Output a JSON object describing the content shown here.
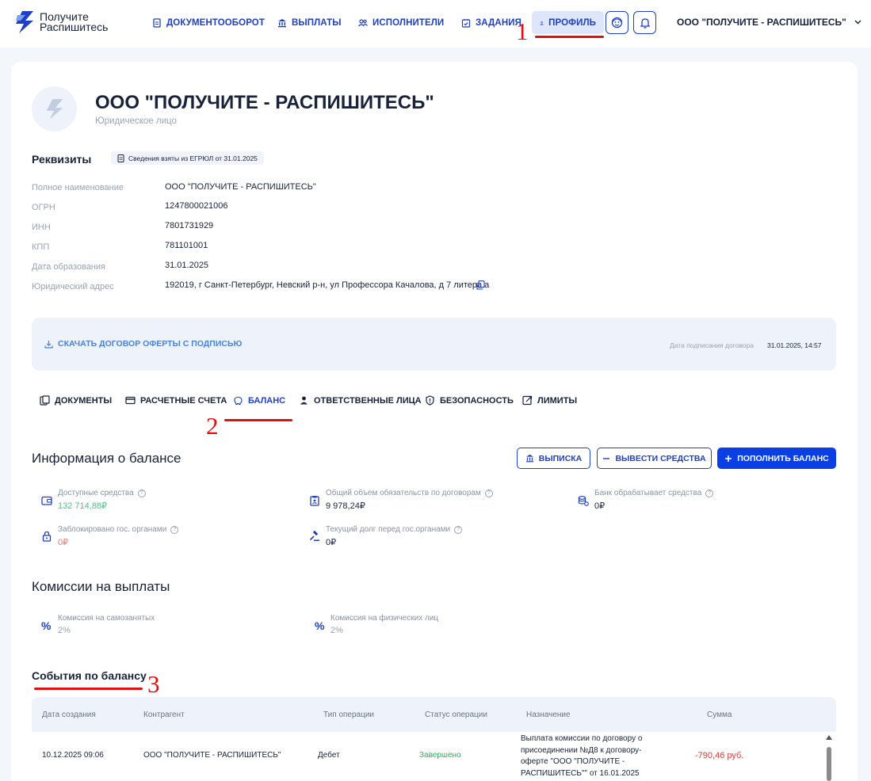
{
  "header": {
    "logo_line1": "Получите",
    "logo_line2": "Распишитесь",
    "nav": [
      {
        "label": "ДОКУМЕНТООБОРОТ",
        "icon": "document-icon"
      },
      {
        "label": "ВЫПЛАТЫ",
        "icon": "bank-icon"
      },
      {
        "label": "ИСПОЛНИТЕЛИ",
        "icon": "users-icon"
      },
      {
        "label": "ЗАДАНИЯ",
        "icon": "calendar-check-icon"
      },
      {
        "label": "ПРОФИЛЬ",
        "icon": "user-icon",
        "active": true
      }
    ],
    "company": "ООО \"ПОЛУЧИТЕ - РАСПИШИТЕСЬ\""
  },
  "annotations": {
    "mark1": "1",
    "mark2": "2",
    "mark3": "3"
  },
  "profile": {
    "name": "ООО \"ПОЛУЧИТЕ - РАСПИШИТЕСЬ\"",
    "type": "Юридическое лицо"
  },
  "requisites": {
    "title": "Реквизиты",
    "egrul_chip": "Сведения взяты из ЕГРЮЛ от 31.01.2025",
    "rows": [
      {
        "label": "Полное наименование",
        "value": "ООО \"ПОЛУЧИТЕ - РАСПИШИТЕСЬ\""
      },
      {
        "label": "ОГРН",
        "value": "1247800021006"
      },
      {
        "label": "ИНН",
        "value": "7801731929"
      },
      {
        "label": "КПП",
        "value": "781101001"
      },
      {
        "label": "Дата образования",
        "value": "31.01.2025"
      },
      {
        "label": "Юридический адрес",
        "value": "192019, г Санкт-Петербург, Невский р-н, ул Профессора Качалова, д 7 литера а"
      }
    ]
  },
  "offer": {
    "download_label": "СКАЧАТЬ ДОГОВОР ОФЕРТЫ С ПОДПИСЬЮ",
    "sign_date_label": "Дата подписания договора",
    "sign_date_value": "31.01.2025, 14:57"
  },
  "tabs": [
    {
      "label": "ДОКУМЕНТЫ"
    },
    {
      "label": "РАСЧЕТНЫЕ СЧЕТА"
    },
    {
      "label": "БАЛАНС",
      "active": true
    },
    {
      "label": "ОТВЕТСТВЕННЫЕ ЛИЦА"
    },
    {
      "label": "БЕЗОПАСНОСТЬ"
    },
    {
      "label": "ЛИМИТЫ"
    }
  ],
  "balance": {
    "title": "Информация о балансе",
    "btn_statement": "ВЫПИСКА",
    "btn_withdraw": "ВЫВЕСТИ СРЕДСТВА",
    "btn_topup": "ПОПОЛНИТЬ БАЛАНС",
    "stats": [
      {
        "label": "Доступные средства",
        "value": "132 714,88₽",
        "color": "#4cc38a"
      },
      {
        "label": "Общий объем обязательств по договорам",
        "value": "9 978,24₽",
        "color": "#18223c"
      },
      {
        "label": "Банк обрабатывает средства",
        "value": "0₽",
        "color": "#18223c"
      },
      {
        "label": "Заблокировано гос. органами",
        "value": "0₽",
        "color": "#e77a7a"
      },
      {
        "label": "Текущий долг перед гос.органами",
        "value": "0₽",
        "color": "#18223c"
      }
    ]
  },
  "commissions": {
    "title": "Комиссии на выплаты",
    "items": [
      {
        "label": "Комиссия на самозанятых",
        "value": "2%"
      },
      {
        "label": "Комиссия на физических лиц",
        "value": "2%"
      }
    ]
  },
  "events": {
    "title": "События по балансу",
    "columns": [
      "Дата создания",
      "Контрагент",
      "Тип операции",
      "Статус операции",
      "Назначение",
      "Сумма"
    ],
    "rows": [
      {
        "date": "10.12.2025 09:06",
        "counterparty": "ООО \"ПОЛУЧИТЕ - РАСПИШИТЕСЬ\"",
        "type": "Дебет",
        "status": "Завершено",
        "purpose_lines": [
          "Выплата комиссии по договору о",
          "присоединении №Д8 к договору-",
          "оферте \"ООО \"ПОЛУЧИТЕ -",
          "РАСПИШИТЕСЬ\"\" от 16.01.2025"
        ],
        "amount": "-790,46 руб."
      }
    ]
  }
}
